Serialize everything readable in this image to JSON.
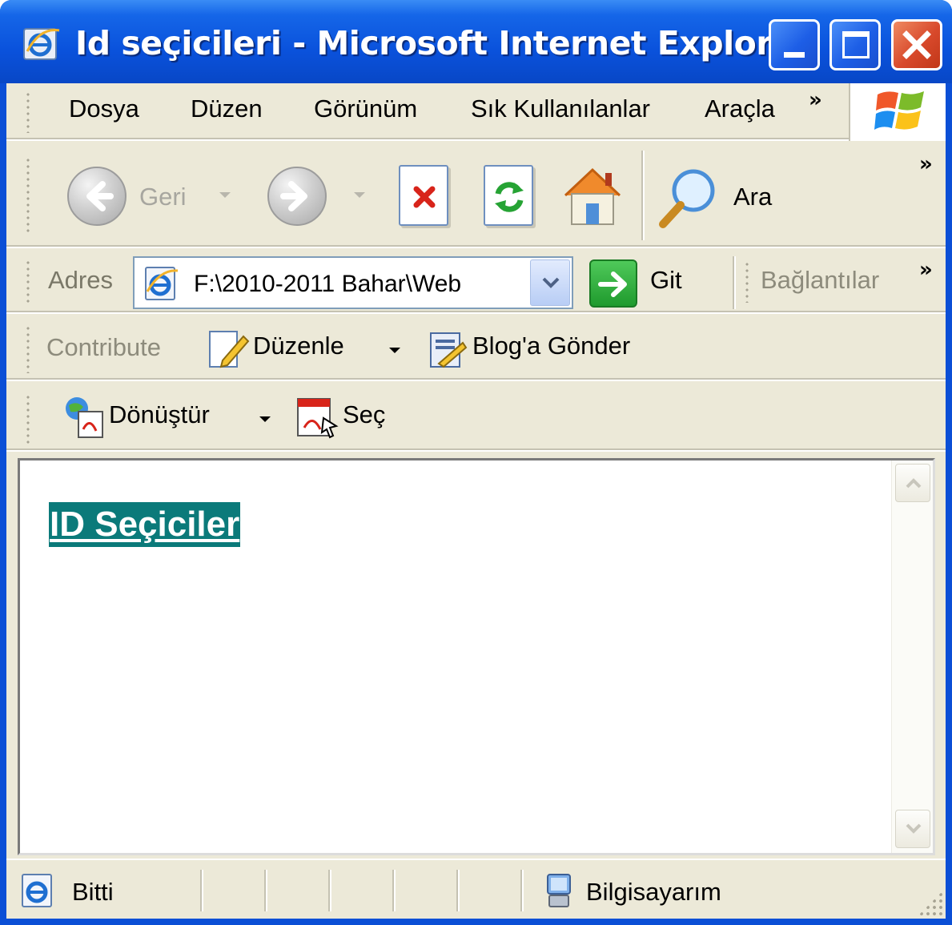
{
  "window": {
    "title": "Id seçicileri - Microsoft Internet Explorer",
    "title_color": "#ffffff",
    "titlebar_color": "#0a52dc"
  },
  "menubar": {
    "items": [
      "Dosya",
      "Düzen",
      "Görünüm",
      "Sık Kullanılanlar",
      "Araçla"
    ],
    "overflow": "»"
  },
  "toolbar": {
    "back_label": "Geri",
    "search_label": "Ara",
    "overflow": "»"
  },
  "addressbar": {
    "label": "Adres",
    "value": "F:\\2010-2011 Bahar\\Web",
    "go_label": "Git",
    "links_label": "Bağlantılar",
    "overflow": "»"
  },
  "contribute_bar": {
    "label": "Contribute",
    "edit_label": "Düzenle",
    "blog_label": "Blog'a Gönder"
  },
  "convert_bar": {
    "convert_label": "Dönüştür",
    "select_label": "Seç"
  },
  "page": {
    "heading": "ID Seçiciler",
    "heading_bg": "#0b7a7a"
  },
  "statusbar": {
    "status": "Bitti",
    "zone": "Bilgisayarım"
  },
  "icons": [
    "ie-icon",
    "minimize-icon",
    "maximize-icon",
    "close-icon",
    "windows-logo-icon",
    "back-icon",
    "forward-icon",
    "stop-icon",
    "refresh-icon",
    "home-icon",
    "search-icon",
    "page-icon",
    "go-arrow-icon",
    "edit-icon",
    "blog-icon",
    "convert-pdf-icon",
    "select-pdf-icon",
    "computer-icon",
    "resize-grip-icon"
  ]
}
